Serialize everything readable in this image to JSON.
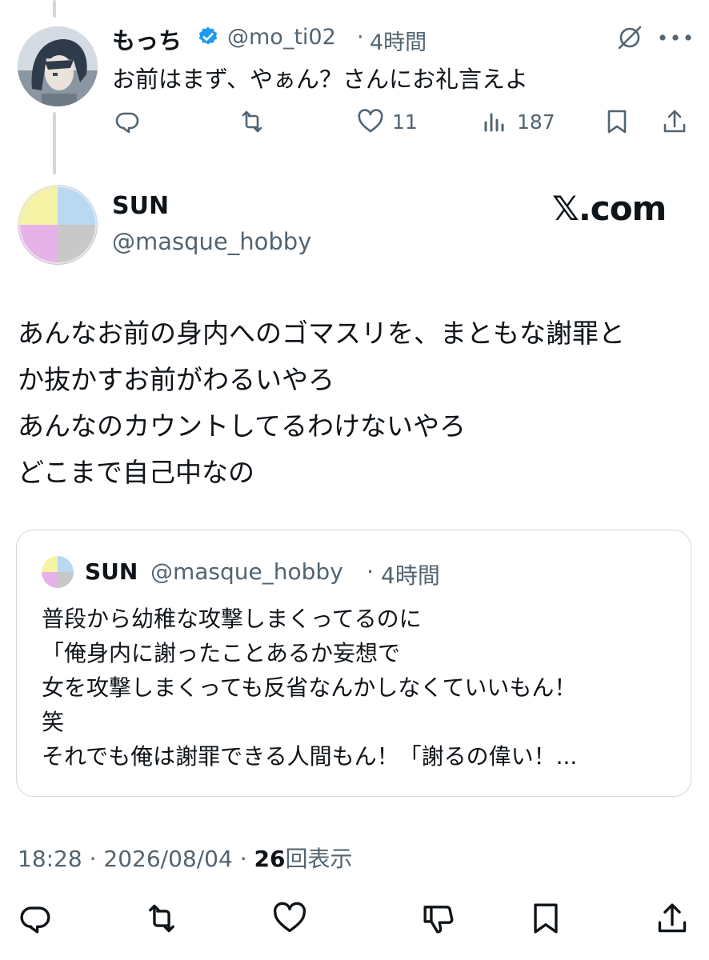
{
  "reply_context": {
    "display_name": "もっち",
    "handle": "@mo_ti02",
    "separator": "·",
    "time": "4時間",
    "text": "お前はまず、やぁん？さんにお礼言えよ",
    "like_count": "11",
    "view_count": "187"
  },
  "main_tweet": {
    "display_name": "SUN",
    "handle": "@masque_hobby",
    "watermark": "𝕏.com",
    "lines": [
      "あんなお前の身内へのゴマスリを、まともな謝罪と",
      "か抜かすお前がわるいやろ",
      "あんなのカウントしてるわけないやろ",
      "どこまで自己中なの"
    ]
  },
  "quoted_tweet": {
    "display_name": "SUN",
    "handle": "@masque_hobby",
    "separator": "·",
    "time": "4時間",
    "lines": [
      "普段から幼稚な攻撃しまくってるのに",
      "「俺身内に謝ったことあるか妄想で",
      "女を攻撃しまくっても反省なんかしなくていいもん！",
      "笑",
      "それでも俺は謝罪できる人間もん！「謝るの偉い！..."
    ]
  },
  "meta": {
    "time": "18:28",
    "sep1": "·",
    "date": "2026/08/04",
    "sep2": "·",
    "views": "26",
    "views_label": "回表示"
  },
  "colors": {
    "verified": "#1d9bf0",
    "muted": "#536471",
    "text": "#0f1419",
    "border": "#cfd9de",
    "avatar_yellow": "#f7f3a6",
    "avatar_blue": "#b9d8f2",
    "avatar_pink": "#e5b3e8",
    "avatar_gray": "#c8c8c8"
  },
  "icons": {
    "reply": "reply-icon",
    "retweet": "retweet-icon",
    "like": "heart-icon",
    "views": "views-icon",
    "bookmark": "bookmark-icon",
    "share": "share-icon",
    "grok": "grok-icon",
    "more": "more-icon",
    "dislike": "dislike-icon"
  }
}
